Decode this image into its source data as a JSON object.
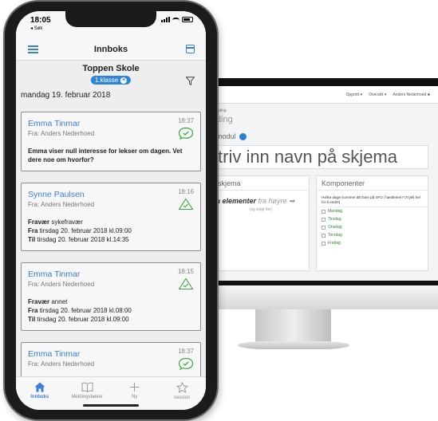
{
  "desktop": {
    "topbar_items": [
      "Opprett ▾",
      "Oversikt ▾",
      "Anders Nederhoed ♣"
    ],
    "breadcrumb": "melding",
    "heading": "ilding",
    "modul_label": "amodul",
    "form_name_placeholder": "triv inn navn på skjema",
    "left_col_title": "skjema",
    "drop_main": "a elementer",
    "drop_main_light": "fra høyre ➡",
    "drop_sub": "(og slipp her)",
    "right_col_title": "Komponenter",
    "component_question": "Hvilke dager kommer ditt barn på SFO i høstferien? (Trykk her for å endre)",
    "component_options": [
      "Mandag",
      "Tirsdag",
      "Onsdag",
      "Torsdag",
      "Fredag"
    ]
  },
  "phone": {
    "status": {
      "time": "18:05",
      "back_label": "◂ Søk"
    },
    "nav": {
      "title": "Innboks"
    },
    "school": {
      "name": "Toppen Skole",
      "class_chip": "1.klasse"
    },
    "date_heading": "mandag 19. februar 2018",
    "messages": [
      {
        "sender": "Emma Tinmar",
        "from": "Fra: Anders Nederhoed",
        "time": "18:37",
        "status": "read",
        "body": "Emma viser null interesse for lekser om dagen. Vet dere noe om hvorfor?"
      },
      {
        "sender": "Synne Paulsen",
        "from": "Fra: Anders Nederhoed",
        "time": "18:16",
        "status": "absence",
        "absence_label": "Fravær",
        "absence_type": "sykefravær",
        "from_label": "Fra",
        "from_date": "tirsdag 20. februar 2018 kl.09:00",
        "to_label": "Til",
        "to_date": "tirsdag 20. februar 2018 kl.14:35"
      },
      {
        "sender": "Emma Tinmar",
        "from": "Fra: Anders Nederhoed",
        "time": "18:15",
        "status": "absence",
        "absence_label": "Fravær",
        "absence_type": "annet",
        "from_label": "Fra",
        "from_date": "tirsdag 20. februar 2018 kl.08:00",
        "to_label": "Til",
        "to_date": "tirsdag 20. februar 2018 kl.09:00"
      },
      {
        "sender": "Emma Tinmar",
        "from": "Fra: Anders Nederhoed",
        "time": "18:37",
        "status": "read"
      }
    ],
    "tabs": [
      {
        "label": "Innboks",
        "icon": "home-icon",
        "active": true
      },
      {
        "label": "Meldingsbøker",
        "icon": "book-icon",
        "active": false
      },
      {
        "label": "Ny",
        "icon": "plus-icon",
        "active": false
      },
      {
        "label": "session",
        "icon": "star-icon",
        "active": false
      }
    ],
    "colors": {
      "accent": "#3b7dd8",
      "read_badge": "#3aa641",
      "chip": "#2d84d8"
    }
  }
}
